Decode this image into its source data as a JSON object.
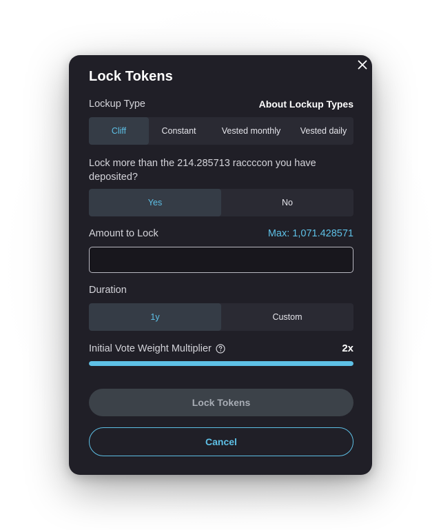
{
  "modal": {
    "title": "Lock Tokens",
    "close_icon": "close-icon"
  },
  "lockup_type": {
    "label": "Lockup Type",
    "about_link": "About Lockup Types",
    "options": [
      "Cliff",
      "Constant",
      "Vested monthly",
      "Vested daily"
    ],
    "selected": "Cliff"
  },
  "lock_more": {
    "question": "Lock more than the 214.285713 raccccon you have deposited?",
    "options": [
      "Yes",
      "No"
    ],
    "selected": "Yes"
  },
  "amount": {
    "label": "Amount to Lock",
    "max_text": "Max: 1,071.428571",
    "value": "",
    "placeholder": ""
  },
  "duration": {
    "label": "Duration",
    "options": [
      "1y",
      "Custom"
    ],
    "selected": "1y"
  },
  "multiplier": {
    "label": "Initial Vote Weight Multiplier",
    "value": "2x",
    "help_icon": "question-circle-icon",
    "progress_fraction": 1.0
  },
  "actions": {
    "primary_label": "Lock Tokens",
    "secondary_label": "Cancel"
  },
  "colors": {
    "accent": "#5ec0e6",
    "modal_bg": "#201f27",
    "segment_bg": "#2a2a33",
    "segment_active_bg": "#353c46"
  }
}
